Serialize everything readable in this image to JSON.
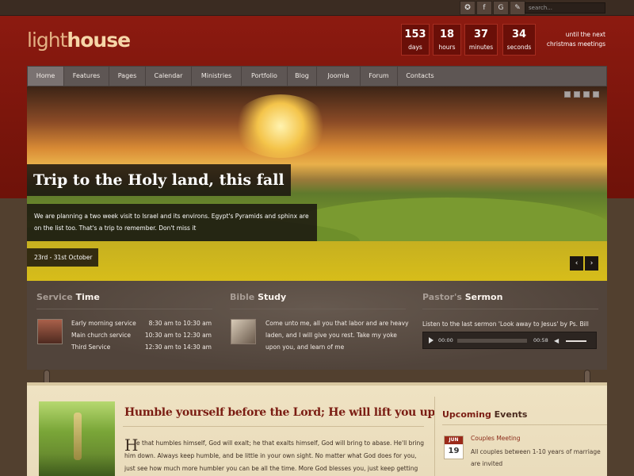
{
  "topbar": {
    "social": [
      "✪",
      "f",
      "G",
      "✎"
    ],
    "search_placeholder": "search..."
  },
  "logo": {
    "part1": "light",
    "part2": "house"
  },
  "countdown": [
    {
      "value": "153",
      "unit": "days"
    },
    {
      "value": "18",
      "unit": "hours"
    },
    {
      "value": "37",
      "unit": "minutes"
    },
    {
      "value": "34",
      "unit": "seconds"
    }
  ],
  "until": {
    "line1": "until the next",
    "line2": "christmas meetings"
  },
  "nav": [
    "Home",
    "Features",
    "Pages",
    "Calendar",
    "Ministries",
    "Portfolio",
    "Blog",
    "Joomla",
    "Forum",
    "Contacts"
  ],
  "slide": {
    "title": "Trip to the Holy land, this fall",
    "text": "We are planning a two week visit to Israel and its environs. Egypt's Pyramids and sphinx are on the list too. That's a trip to remember. Don't miss it",
    "date": "23rd - 31st October",
    "prev": "‹",
    "next": "›"
  },
  "service": {
    "title_a": "Service",
    "title_b": "Time",
    "rows": [
      {
        "name": "Early morning service",
        "time": "8:30 am to 10:30 am"
      },
      {
        "name": "Main church service",
        "time": "10:30 am to 12:30 am"
      },
      {
        "name": "Third Service",
        "time": "12:30 am to 14:30 am"
      }
    ]
  },
  "bible": {
    "title_a": "Bible",
    "title_b": "Study",
    "text": "Come unto me, all you that labor and are heavy laden, and I will give you rest. Take my yoke upon you, and learn of me"
  },
  "sermon": {
    "title_a": "Pastor's",
    "title_b": "Sermon",
    "text": "Listen to the last sermon 'Look away to Jesus' by Ps. Bill",
    "time_current": "00:00",
    "time_total": "00:58"
  },
  "post": {
    "title": "Humble yourself before the Lord; He will lift you up",
    "dropcap": "H",
    "line1": "e that humbles himself, God will exalt; he that exalts himself, God will bring to abase. He'll bring",
    "rest": "him down. Always keep humble, and be little in your own sight. No matter what God does for you, just see how much more humbler you can be all the time. More God blesses you, just keep getting more humble all the time. He can continue to bless"
  },
  "events": {
    "title_a": "Upcoming",
    "title_b": "Events",
    "items": [
      {
        "month": "JUN",
        "day": "19",
        "name": "Couples Meeting",
        "desc": "All couples between 1-10 years of marriage are invited"
      }
    ]
  }
}
